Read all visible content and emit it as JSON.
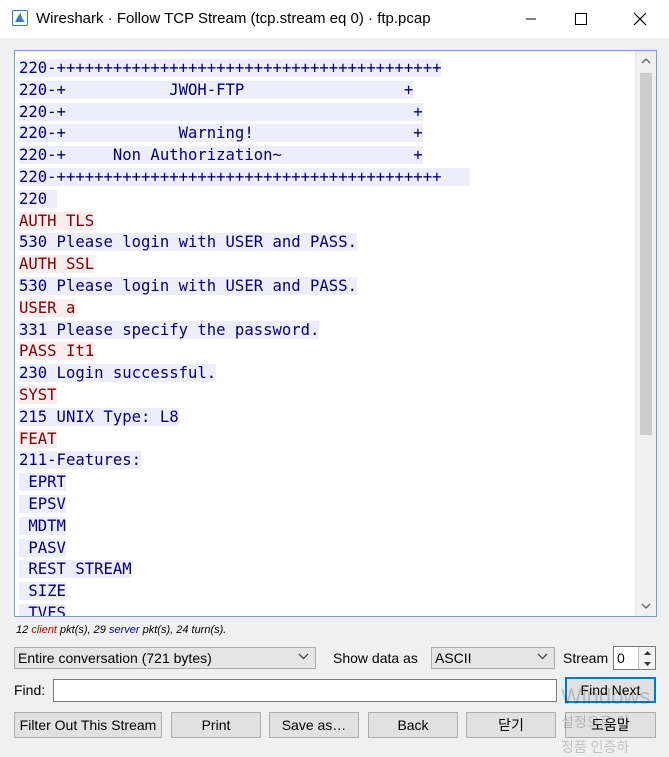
{
  "window": {
    "title": "Wireshark · Follow TCP Stream (tcp.stream eq 0) · ftp.pcap",
    "colors": {
      "client_fg": "#7f0000",
      "client_bg": "#fbeded",
      "server_fg": "#00007f",
      "server_bg": "#ededfb"
    }
  },
  "stream": {
    "lines": [
      {
        "dir": "server",
        "text": "220-+++++++++++++++++++++++++++++++++++++++++"
      },
      {
        "dir": "server",
        "text": "220-+           JWOH-FTP                 +"
      },
      {
        "dir": "server",
        "text": "220-+                                     +"
      },
      {
        "dir": "server",
        "text": "220-+            Warning!                 +"
      },
      {
        "dir": "server",
        "text": "220-+     Non Authorization~              +"
      },
      {
        "dir": "server",
        "text": "220-+++++++++++++++++++++++++++++++++++++++++   "
      },
      {
        "dir": "server",
        "text": "220 "
      },
      {
        "dir": "client",
        "text": "AUTH TLS"
      },
      {
        "dir": "server",
        "text": "530 Please login with USER and PASS."
      },
      {
        "dir": "client",
        "text": "AUTH SSL"
      },
      {
        "dir": "server",
        "text": "530 Please login with USER and PASS."
      },
      {
        "dir": "client",
        "text": "USER a"
      },
      {
        "dir": "server",
        "text": "331 Please specify the password."
      },
      {
        "dir": "client",
        "text": "PASS It1"
      },
      {
        "dir": "server",
        "text": "230 Login successful."
      },
      {
        "dir": "client",
        "text": "SYST"
      },
      {
        "dir": "server",
        "text": "215 UNIX Type: L8"
      },
      {
        "dir": "client",
        "text": "FEAT"
      },
      {
        "dir": "server",
        "text": "211-Features:"
      },
      {
        "dir": "server",
        "text": " EPRT"
      },
      {
        "dir": "server",
        "text": " EPSV"
      },
      {
        "dir": "server",
        "text": " MDTM"
      },
      {
        "dir": "server",
        "text": " PASV"
      },
      {
        "dir": "server",
        "text": " REST STREAM"
      },
      {
        "dir": "server",
        "text": " SIZE"
      },
      {
        "dir": "server",
        "text": " TVFS"
      }
    ]
  },
  "summary": {
    "client_count": "12",
    "client_word": "client",
    "pkts1": " pkt(s), ",
    "server_count": "29",
    "server_word": "server",
    "pkts2": " pkt(s), 24 turn(s)."
  },
  "controls": {
    "conversation": "Entire conversation (721 bytes)",
    "show_data_label": "Show data as",
    "show_data_value": "ASCII",
    "stream_label": "Stream",
    "stream_value": "0",
    "find_label": "Find:",
    "find_value": "",
    "find_next": "Find Next"
  },
  "buttons": {
    "filter_out": "Filter Out This Stream",
    "print": "Print",
    "save_as": "Save as…",
    "back": "Back",
    "close": "닫기",
    "help": "도움말"
  },
  "watermark": {
    "line1": "Windows",
    "line2": "설정으로 이",
    "line3": "정품 인증하"
  }
}
